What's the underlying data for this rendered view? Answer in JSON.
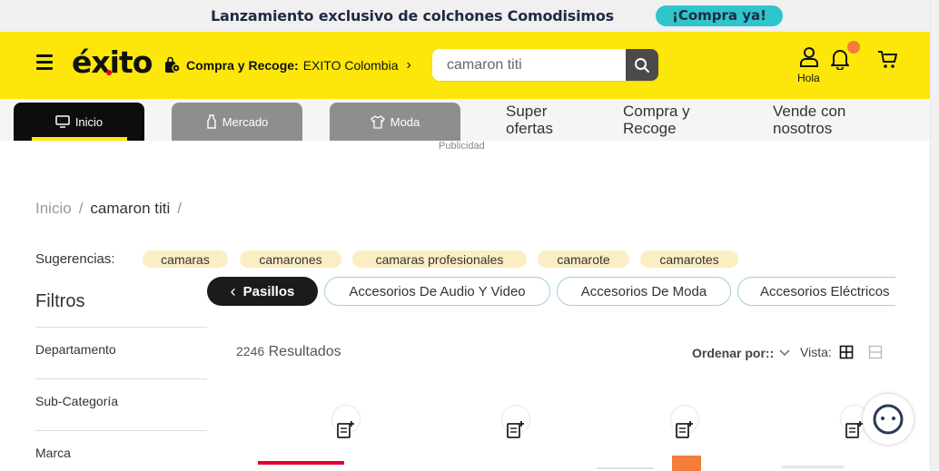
{
  "promo": {
    "text": "Lanzamiento exclusivo de colchones Comodisimos",
    "cta": "¡Compra ya!"
  },
  "header": {
    "logo": "éxito",
    "compra_recoge_bold": "Compra y Recoge:",
    "compra_recoge_store": "EXITO Colombia",
    "search_value": "camaron titi",
    "user_label": "Hola",
    "brand_yellow": "#fde70a",
    "icons": [
      "menu-icon",
      "bag-pin-icon",
      "search-icon",
      "user-icon",
      "bell-icon",
      "cart-icon"
    ]
  },
  "nav": {
    "tabs": [
      {
        "label": "Inicio",
        "icon": "monitor-icon",
        "active": true
      },
      {
        "label": "Mercado",
        "icon": "bottle-icon",
        "active": false
      },
      {
        "label": "Moda",
        "icon": "shirt-icon",
        "active": false
      }
    ],
    "links": [
      "Super ofertas",
      "Compra y Recoge",
      "Vende con nosotros"
    ],
    "ad_label": "Publicidad"
  },
  "breadcrumb": {
    "home": "Inicio",
    "separator": "/",
    "current": "camaron titi"
  },
  "suggestions": {
    "label": "Sugerencias:",
    "items": [
      "camaras",
      "camarones",
      "camaras profesionales",
      "camarote",
      "camarotes"
    ]
  },
  "filters": {
    "title": "Filtros",
    "items": [
      "Departamento",
      "Sub-Categoría",
      "Marca"
    ]
  },
  "pasillos": {
    "main": "Pasillos",
    "items": [
      "Accesorios De Audio Y Video",
      "Accesorios De Moda",
      "Accesorios Eléctricos"
    ]
  },
  "results": {
    "count": "2246",
    "label": "Resultados",
    "order_label": "Ordenar por::",
    "view_label": "Vista:"
  }
}
